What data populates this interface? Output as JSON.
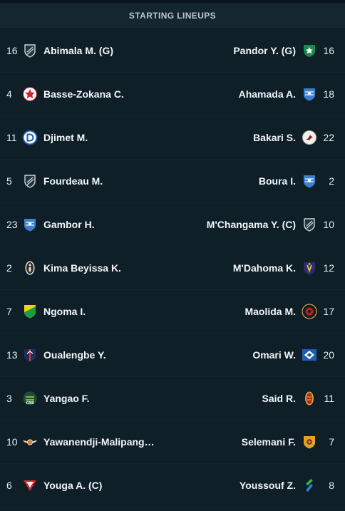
{
  "header": {
    "title": "STARTING LINEUPS"
  },
  "lineups": [
    {
      "home": {
        "number": "16",
        "name": "Abimala M. (G)",
        "icon": "generic-shield-icon"
      },
      "away": {
        "number": "16",
        "name": "Pandor Y. (G)",
        "icon": "green-star-crest-icon"
      }
    },
    {
      "home": {
        "number": "4",
        "name": "Basse-Zokana C.",
        "icon": "red-star-crest-icon"
      },
      "away": {
        "number": "18",
        "name": "Ahamada A.",
        "icon": "blue-crest-icon"
      }
    },
    {
      "home": {
        "number": "11",
        "name": "Djimet M.",
        "icon": "blue-d-crest-icon"
      },
      "away": {
        "number": "22",
        "name": "Bakari S.",
        "icon": "bird-crest-icon"
      }
    },
    {
      "home": {
        "number": "5",
        "name": "Fourdeau M.",
        "icon": "generic-shield-icon"
      },
      "away": {
        "number": "2",
        "name": "Boura I.",
        "icon": "blue-crest-icon"
      }
    },
    {
      "home": {
        "number": "23",
        "name": "Gambor H.",
        "icon": "blue-crest-icon"
      },
      "away": {
        "number": "10",
        "name": "M'Changama Y. (C)",
        "icon": "generic-shield-icon"
      }
    },
    {
      "home": {
        "number": "2",
        "name": "Kima Beyissa K.",
        "icon": "dark-figure-crest-icon"
      },
      "away": {
        "number": "12",
        "name": "M'Dahoma K.",
        "icon": "navy-yellow-crest-icon"
      }
    },
    {
      "home": {
        "number": "7",
        "name": "Ngoma I.",
        "icon": "yellow-green-shield-icon"
      },
      "away": {
        "number": "17",
        "name": "Maolida M.",
        "icon": "black-red-badge-icon"
      }
    },
    {
      "home": {
        "number": "13",
        "name": "Oualengbe Y.",
        "icon": "navy-red-shield-icon"
      },
      "away": {
        "number": "20",
        "name": "Omari W.",
        "icon": "blue-diamond-flag-icon"
      }
    },
    {
      "home": {
        "number": "3",
        "name": "Yangao F.",
        "icon": "green-crb-crest-icon"
      },
      "away": {
        "number": "11",
        "name": "Said R.",
        "icon": "red-gold-crest-icon"
      }
    },
    {
      "home": {
        "number": "10",
        "name": "Yawanendji-Malipang…",
        "icon": "winged-crest-icon"
      },
      "away": {
        "number": "7",
        "name": "Selemani F.",
        "icon": "gold-shield-icon"
      }
    },
    {
      "home": {
        "number": "6",
        "name": "Youga A. (C)",
        "icon": "red-white-chevron-icon"
      },
      "away": {
        "number": "8",
        "name": "Youssouf Z.",
        "icon": "green-blue-slash-icon"
      }
    }
  ]
}
